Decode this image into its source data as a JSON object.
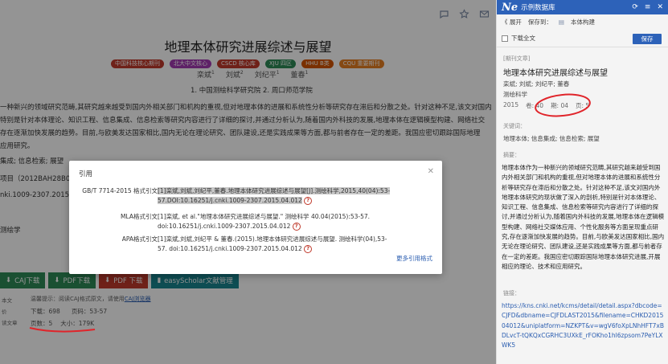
{
  "article": {
    "title": "地理本体研究进展综述与展望",
    "badges": [
      {
        "label": "中国科技核心期刊",
        "color": "#c0392b"
      },
      {
        "label": "北大中文核心",
        "color": "#a33ab2"
      },
      {
        "label": "CSCD 核心库",
        "color": "#c0392b"
      },
      {
        "label": "XJU 四区",
        "color": "#2e8b57"
      },
      {
        "label": "HHU B类",
        "color": "#d35400"
      },
      {
        "label": "CQU 重要期刊",
        "color": "#e67e22"
      }
    ],
    "authors": [
      {
        "name": "栾斌",
        "sup": "1"
      },
      {
        "name": "刘斌",
        "sup": "2"
      },
      {
        "name": "刘纪平",
        "sup": "1"
      },
      {
        "name": "董春",
        "sup": "1"
      }
    ],
    "orgs": "1. 中国测绘科学研究院  2. 周口师范学院",
    "abstract_lines": [
      "一种新兴的领域研究范畴,其研究越来越受到国内外相关部门和机构的重视,但对地理本体的进展和系统性分析等研究存在滞后和分散之处。针对这种不足,该文对国内",
      "特别是针对本体理论、知识工程、信息集成、信息检索等研究内容进行了详细的探讨,并通过分析认为,随着国内外科技的发展,地理本体在逻辑模型构建、网络社交",
      "存在逐渐加快发展的趋势。目前,与欧美发达国家相比,国内无论在理论研究、团队建设,还是实践成果等方面,都与前者存在一定的差距。我国应密切跟踪国际地理",
      "应用研究。"
    ],
    "keywords": "集成;  信息检索;  展望",
    "fund": "项目（2012BAH28B0",
    "doi": "nki.1009-2307.2015.0",
    "classification": "测绘学",
    "download_buttons": {
      "caj": "CAJ下载",
      "pdf1": "PDF下载",
      "pdf2": "PDF 下载",
      "es": "easyScholar文献管理"
    },
    "hint_prefix": "温馨提示：阅读CAJ格式原文，请使用",
    "hint_link": "CAJ浏览器",
    "downloads": "下载：698",
    "page_code": "页码：53-57",
    "pages": "页数：5",
    "size": "大小：179K",
    "side_labels": [
      "本文",
      "价",
      "读文章"
    ],
    "icons": [
      "chat-icon",
      "star-icon",
      "mail-icon",
      "settings-icon"
    ]
  },
  "dialog": {
    "title": "引用",
    "close": "✕",
    "rows": [
      {
        "label": "GB/T 7714-2015 格式引文",
        "text": "[1]栾斌,刘斌,刘纪平,董春.地理本体研究进展综述与展望[J].测绘科学,2015,40(04):53-57.DOI:10.16251/j.cnki.1009-2307.2015.04.012",
        "highlight": true
      },
      {
        "label": "MLA格式引文",
        "text": "[1]栾斌, et al.\"地理本体研究进展综述与展望.\" 测绘科学 40.04(2015):53-57. doi:10.16251/j.cnki.1009-2307.2015.04.012",
        "highlight": false
      },
      {
        "label": "APA格式引文",
        "text": "[1]栾斌,刘斌,刘纪平 & 董春.(2015).地理本体研究进展综述与展望. 测绘科学(04),53-57. doi:10.16251/j.cnki.1009-2307.2015.04.012",
        "highlight": false
      }
    ],
    "more": "更多引用格式"
  },
  "panel": {
    "logo": "Ne",
    "title": "示例数据库",
    "nav_expand": "《 展开",
    "nav_save_to": "保存到：",
    "nav_folder": "本体构建",
    "fulltext_label": "下载全文",
    "save_button": "保存",
    "tag": "[期刊文章]",
    "title_text": "地理本体研究进展综述与展望",
    "authors": "栾斌; 刘斌; 刘纪平; 董春",
    "journal": "测绘科学",
    "meta": [
      "2015",
      "卷: 40",
      "期: 04",
      "页: 5"
    ],
    "keywords_label": "关键词：",
    "keywords": "地理本体; 信息集成; 信息检索; 展望",
    "abstract_label": "摘要：",
    "abstract": "地理本体作为一种新兴的领域研究范畴,其研究越来越受到国内外相关部门和机构的重视,但对地理本体的进展和系统性分析等研究存在滞后和分散之处。针对这种不足,该文对国内外地理本体研究的现状做了深入的剖析,特别是针对本体理论、知识工程、信息集成、信息检索等研究内容进行了详细的探讨,并通过分析认为,随着国内外科技的发展,地理本体在逻辑模型构建、网络社交媒体应用、个性化服务等方面呈现重点研究,存在逐渐加快发展的趋势。目前,与欧美发达国家相比,国内无论在理论研究、团队建设,还是实践成果等方面,都与前者存在一定的差距。我国应密切跟踪国际地理本体研究进展,开展相应的理论、技术和应用研究。",
    "link_label": "链接：",
    "link": "https://kns.cnki.net/kcms/detail/detail.aspx?dbcode=CJFD&dbname=CJFDLAST2015&filename=CHKD201504012&uniplatform=NZKPT&v=wgV6foXpLNhHFT7xBDLvcT-tQKQxCGRHC3UXkE_rFOKho1hl6zpsom7PeYLXWK5",
    "header_icons": [
      "refresh-icon",
      "menu-icon",
      "close-icon"
    ]
  },
  "colors": {
    "accent": "#2d62b9",
    "annotation": "#e0242a"
  }
}
